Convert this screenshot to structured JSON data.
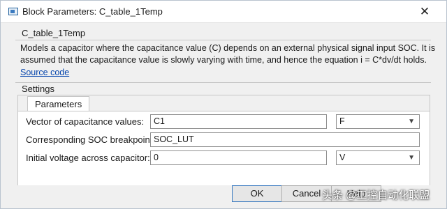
{
  "window": {
    "title": "Block Parameters: C_table_1Temp"
  },
  "block": {
    "name": "C_table_1Temp",
    "description_line1": "Models a capacitor where the capacitance value (C) depends on an external physical signal input SOC. It is",
    "description_line2": "assumed that the capacitance value is slowly varying with time, and hence the equation i = C*dv/dt holds.",
    "source_link": "Source code"
  },
  "settings": {
    "label": "Settings",
    "tabs": [
      {
        "label": "Parameters",
        "active": true
      }
    ],
    "parameters": [
      {
        "label": "Vector of capacitance values:",
        "value": "C1",
        "unit": "F"
      },
      {
        "label": "Corresponding SOC breakpoints:",
        "value": "SOC_LUT"
      },
      {
        "label": "Initial voltage across capacitor:",
        "value": "0",
        "unit": "V"
      }
    ]
  },
  "buttons": {
    "ok": "OK",
    "cancel": "Cancel",
    "help": "Help"
  },
  "watermark": "头条 @工控自动化联盟",
  "icons": {
    "close": "close-icon",
    "app": "block-parameters-icon",
    "dropdown": "chevron-down-icon"
  },
  "colors": {
    "link": "#0645ad",
    "primary_button_border": "#3a7ac0"
  }
}
